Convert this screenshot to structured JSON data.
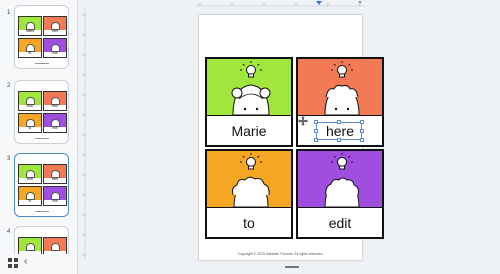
{
  "sidebar": {
    "pages": [
      {
        "number": "1",
        "words": [
          "Marie",
          "here",
          "to",
          "edit"
        ],
        "selected": false
      },
      {
        "number": "2",
        "words": [
          "click",
          "here",
          "to",
          "edit"
        ],
        "selected": false
      },
      {
        "number": "3",
        "words": [
          "click",
          "here",
          "to",
          "edit"
        ],
        "selected": true
      },
      {
        "number": "4",
        "words": [],
        "selected": false
      }
    ],
    "grid_icon": "grid-view-icon",
    "collapse_icon": "chevron-left-icon"
  },
  "cards": [
    {
      "word": "Marie",
      "color": "#a0e63c"
    },
    {
      "word": "here",
      "color": "#f47a55"
    },
    {
      "word": "to",
      "color": "#f5a623"
    },
    {
      "word": "edit",
      "color": "#a04ee0"
    }
  ],
  "selection": {
    "icon": "move-icon"
  },
  "footer": {
    "copyright": "Copyright © 2023 Adelaide Furlowe. All rights reserved."
  },
  "colors": {
    "accent": "#4d88c8",
    "ruler_marker": "#3a7bd5"
  }
}
